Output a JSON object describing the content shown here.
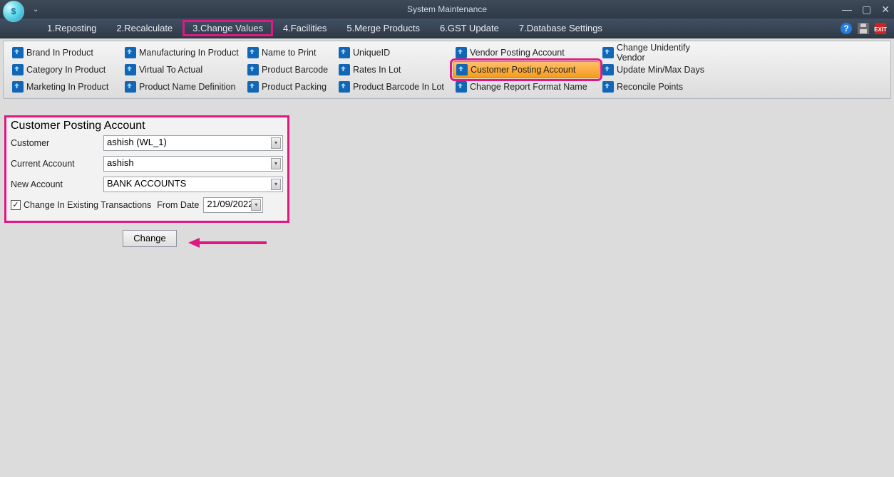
{
  "titlebar": {
    "title": "System Maintenance"
  },
  "menu": {
    "items": [
      "1.Reposting",
      "2.Recalculate",
      "3.Change Values",
      "4.Facilities",
      "5.Merge Products",
      "6.GST Update",
      "7.Database Settings"
    ]
  },
  "ribbon": {
    "cols": [
      [
        "Brand In Product",
        "Category In Product",
        "Marketing In Product"
      ],
      [
        "Manufacturing In Product",
        "Virtual To Actual",
        "Product Name Definition"
      ],
      [
        "Name to Print",
        "Product Barcode",
        "Product Packing"
      ],
      [
        "UniqueID",
        "Rates In Lot",
        "Product Barcode In Lot"
      ],
      [
        "Vendor Posting Account",
        "Customer Posting Account",
        "Change Report Format Name"
      ],
      [
        "Change Unidentify Vendor",
        "Update Min/Max Days",
        "Reconcile Points"
      ]
    ]
  },
  "panel": {
    "legend": "Customer Posting Account",
    "labels": {
      "customer": "Customer",
      "current_account": "Current Account",
      "new_account": "New Account",
      "change_existing": "Change In Existing Transactions",
      "from_date": "From Date"
    },
    "values": {
      "customer": "ashish (WL_1)",
      "current_account": "ashish",
      "new_account": "BANK ACCOUNTS",
      "from_date": "21/09/2022"
    },
    "change_button": "Change"
  }
}
